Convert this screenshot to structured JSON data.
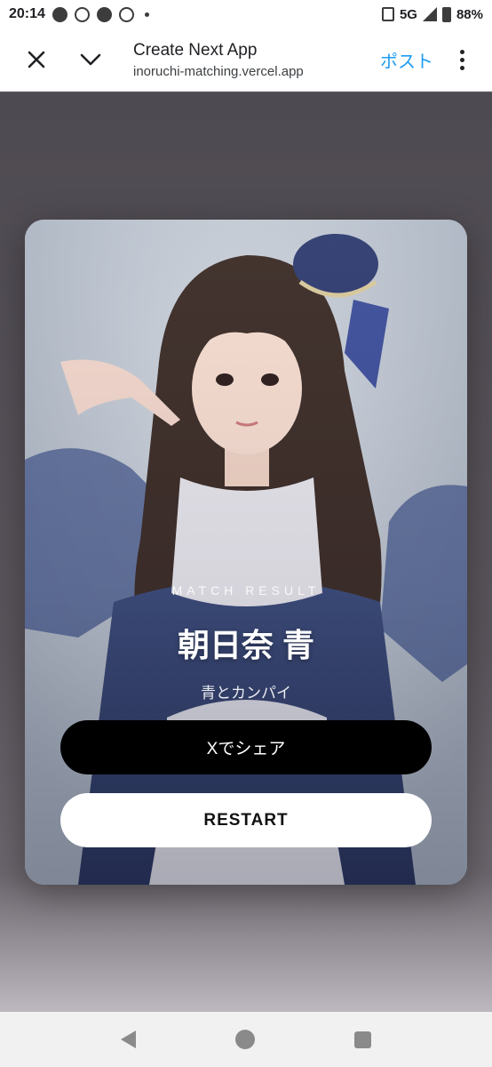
{
  "status_bar": {
    "time": "20:14",
    "network": "5G",
    "battery": "88%",
    "icons": [
      "facebook-icon",
      "pokeball-icon",
      "shield-app-icon",
      "atom-app-icon",
      "dot-icon",
      "vibrate-icon",
      "signal-icon",
      "battery-icon"
    ]
  },
  "toolbar": {
    "title": "Create Next App",
    "url": "inoruchi-matching.vercel.app",
    "post_label": "ポスト",
    "post_color": "#1d9bf0"
  },
  "result": {
    "label": "MATCH RESULT",
    "name": "朝日奈 青",
    "song": "青とカンパイ"
  },
  "buttons": {
    "share": "Xでシェア",
    "restart": "RESTART"
  },
  "colors": {
    "share_bg": "#000000",
    "restart_bg": "#ffffff",
    "page_bg": "#5f5a60"
  }
}
